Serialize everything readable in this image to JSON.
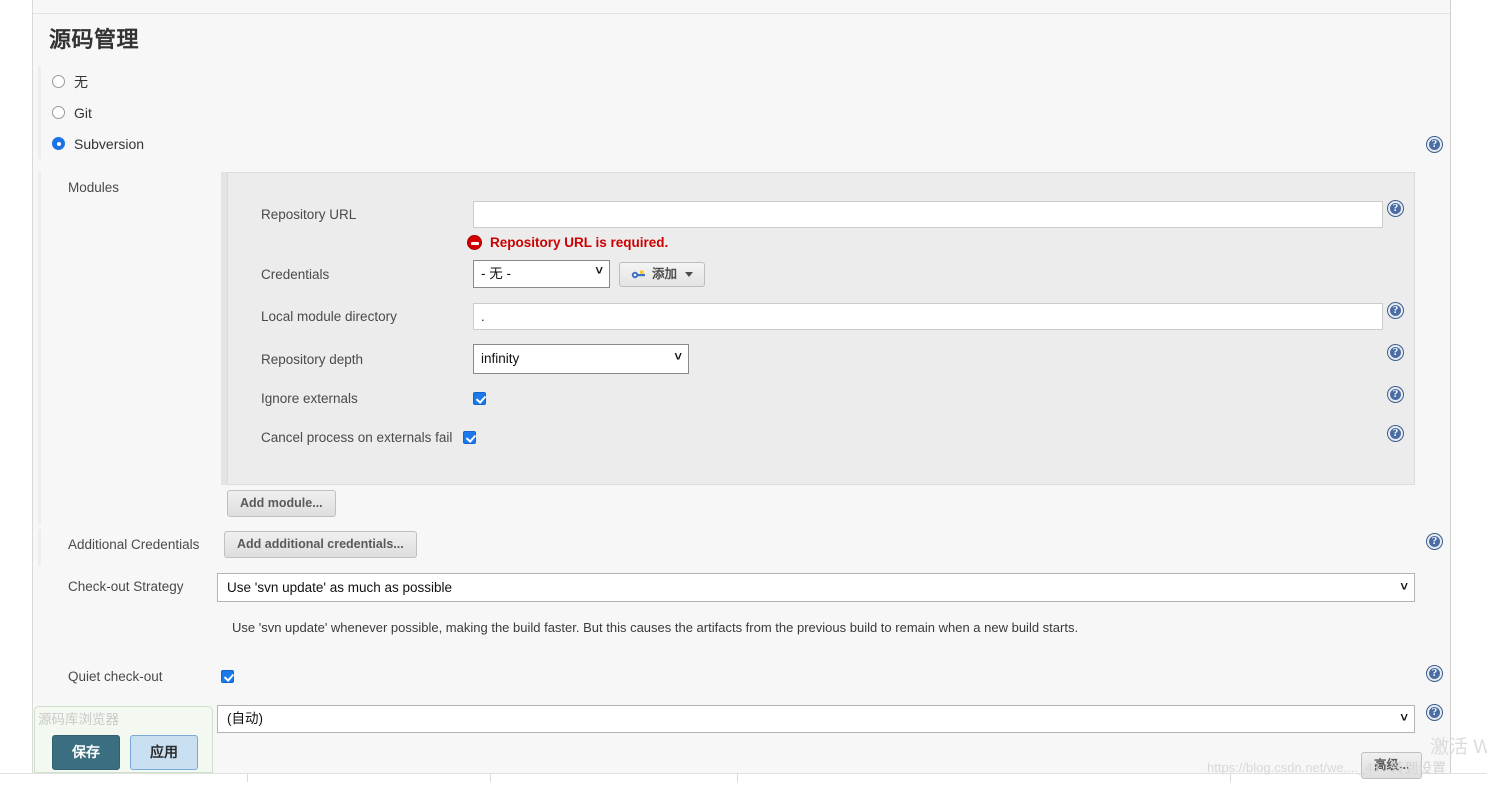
{
  "page": {
    "title": "源码管理"
  },
  "scm": {
    "options": [
      {
        "label": "无",
        "selected": false
      },
      {
        "label": "Git",
        "selected": false
      },
      {
        "label": "Subversion",
        "selected": true
      }
    ],
    "help_icon": "help-icon"
  },
  "modules": {
    "label": "Modules",
    "repository_url": {
      "label": "Repository URL",
      "value": "",
      "error": "Repository URL is required.",
      "error_icon": "error-icon"
    },
    "credentials": {
      "label": "Credentials",
      "selected": "- 无 -",
      "add_button": "添加",
      "add_button_icon": "key-icon"
    },
    "local_module_directory": {
      "label": "Local module directory",
      "value": "."
    },
    "repository_depth": {
      "label": "Repository depth",
      "selected": "infinity"
    },
    "ignore_externals": {
      "label": "Ignore externals",
      "checked": true
    },
    "cancel_on_externals_fail": {
      "label": "Cancel process on externals fail",
      "checked": true
    },
    "add_module_button": "Add module..."
  },
  "additional_credentials": {
    "label": "Additional Credentials",
    "button": "Add additional credentials..."
  },
  "checkout_strategy": {
    "label": "Check-out Strategy",
    "selected": "Use 'svn update' as much as possible",
    "description": "Use 'svn update' whenever possible, making the build faster. But this causes the artifacts from the previous build to remain when a new build starts."
  },
  "quiet_checkout": {
    "label": "Quiet check-out",
    "checked": true
  },
  "repository_browser": {
    "label": "源码库浏览器",
    "selected": "(自动)"
  },
  "advanced_button": "高级...",
  "action_bar": {
    "save": "保存",
    "apply": "应用"
  },
  "watermarks": {
    "csdn": "https://blog.csdn.net/we...._43....",
    "windows_line1": "激活 W",
    "windows_line2": "转到设置"
  },
  "colors": {
    "accent_blue": "#1a7aeb",
    "error_red": "#cc0000",
    "save_teal": "#3b6e80",
    "apply_blue": "#c9dff2",
    "help_blue": "#4a6ea4"
  }
}
